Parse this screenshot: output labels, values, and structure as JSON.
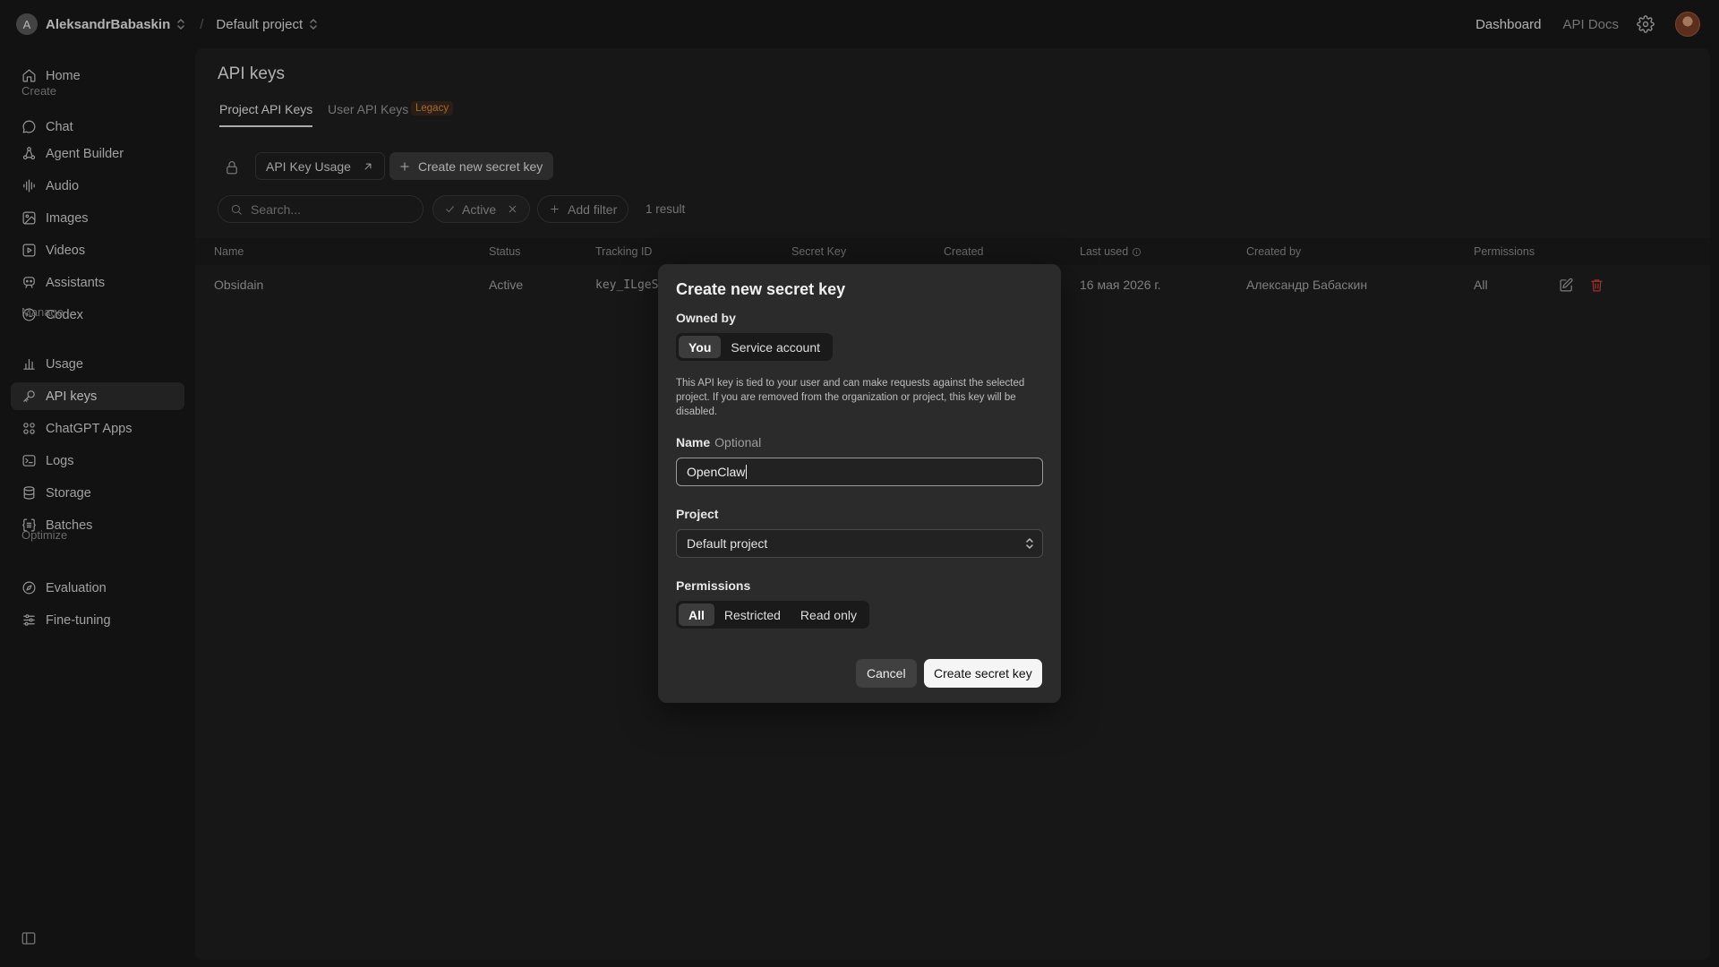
{
  "topbar": {
    "org_initial": "A",
    "org_name": "AleksandrBabaskin",
    "separator": "/",
    "project_name": "Default project",
    "dashboard_link": "Dashboard",
    "docs_link": "API Docs"
  },
  "sidebar": {
    "home": "Home",
    "create_section": "Create",
    "create_items": [
      "Chat",
      "Agent Builder",
      "Audio",
      "Images",
      "Videos",
      "Assistants",
      "Codex"
    ],
    "manage_section": "Manage",
    "manage_items": [
      "Usage",
      "API keys",
      "ChatGPT Apps",
      "Logs",
      "Storage",
      "Batches"
    ],
    "optimize_section": "Optimize",
    "optimize_items": [
      "Evaluation",
      "Fine-tuning"
    ],
    "active_item": "API keys"
  },
  "page": {
    "title": "API keys",
    "tabs": [
      {
        "label": "Project API Keys",
        "active": true
      },
      {
        "label": "User API Keys",
        "active": false,
        "badge": "Legacy"
      }
    ],
    "usage_button": "API Key Usage",
    "create_button": "Create new secret key",
    "search_placeholder": "Search...",
    "active_filter": "Active",
    "add_filter": "Add filter",
    "result_count": "1 result"
  },
  "table": {
    "columns": [
      "Name",
      "Status",
      "Tracking ID",
      "Secret Key",
      "Created",
      "Last used",
      "Created by",
      "Permissions"
    ],
    "rows": [
      {
        "name": "Obsidain",
        "status": "Active",
        "tracking_id": "key_ILgeS",
        "last_used": "16 мая 2026 г.",
        "created_by": "Александр Бабаскин",
        "permissions": "All"
      }
    ]
  },
  "modal": {
    "title": "Create new secret key",
    "owned_by_label": "Owned by",
    "owned_by_options": [
      "You",
      "Service account"
    ],
    "owned_by_selected": "You",
    "description": "This API key is tied to your user and can make requests against the selected project. If you are removed from the organization or project, this key will be disabled.",
    "name_label": "Name",
    "name_optional": "Optional",
    "name_value": "OpenClaw",
    "project_label": "Project",
    "project_value": "Default project",
    "permissions_label": "Permissions",
    "permissions_options": [
      "All",
      "Restricted",
      "Read only"
    ],
    "permissions_selected": "All",
    "cancel_button": "Cancel",
    "submit_button": "Create secret key"
  },
  "colors": {
    "background": "#181818",
    "panel": "#1f1f1f",
    "modal": "#2b2b2b",
    "legacy_badge": "#d98b40",
    "delete_icon": "#d0453a"
  }
}
